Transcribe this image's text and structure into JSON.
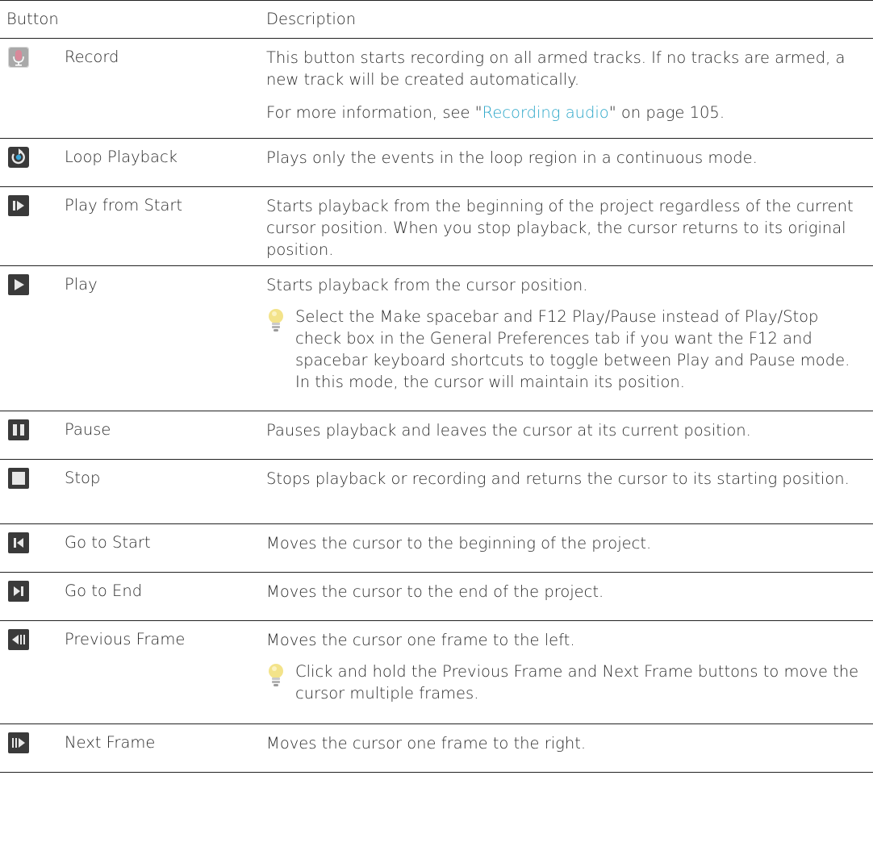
{
  "header": {
    "button": "Button",
    "description": "Description"
  },
  "rows": [
    {
      "icon": "record-icon",
      "name": "Record",
      "desc1": "This button starts recording on all armed tracks. If no tracks are armed, a new track will be created automatically.",
      "desc2_prefix": "For more information, see \"",
      "desc2_link": "Recording audio",
      "desc2_suffix": "\" on page 105."
    },
    {
      "icon": "loop-playback-icon",
      "name": "Loop Playback",
      "desc": "Plays only the events in the loop region in a continuous mode."
    },
    {
      "icon": "play-from-start-icon",
      "name": "Play from Start",
      "desc": "Starts playback from the beginning of the project regardless of the current cursor position. When you stop playback, the cursor returns to its original position."
    },
    {
      "icon": "play-icon",
      "name": "Play",
      "desc": "Starts playback from the cursor position.",
      "tip": "Select the Make spacebar and F12 Play/Pause instead of Play/Stop check box in the General Preferences tab if you want the F12 and spacebar keyboard shortcuts to toggle between Play and Pause mode. In this mode, the cursor will maintain its position."
    },
    {
      "icon": "pause-icon",
      "name": "Pause",
      "desc": "Pauses playback and leaves the cursor at its current position."
    },
    {
      "icon": "stop-icon",
      "name": "Stop",
      "desc": "Stops playback or recording and returns the cursor to its starting position."
    },
    {
      "icon": "go-to-start-icon",
      "name": "Go to Start",
      "desc": "Moves the cursor to the beginning of the project."
    },
    {
      "icon": "go-to-end-icon",
      "name": "Go to End",
      "desc": "Moves the cursor to the end of the project."
    },
    {
      "icon": "previous-frame-icon",
      "name": "Previous Frame",
      "desc": "Moves the cursor one frame to the left.",
      "tip": "Click and hold the Previous Frame and Next Frame buttons to move the cursor multiple frames."
    },
    {
      "icon": "next-frame-icon",
      "name": "Next Frame",
      "desc": "Moves the cursor one frame to the right."
    }
  ],
  "colors": {
    "link": "#2aa6c8",
    "icon_bg": "#3a3a3a",
    "icon_fg": "#e8e8e8",
    "record_mic": "#d9899a",
    "tip_bulb": "#f3e38a"
  }
}
